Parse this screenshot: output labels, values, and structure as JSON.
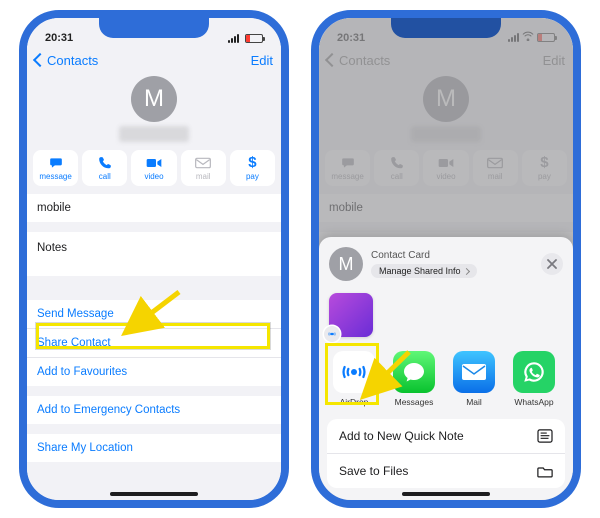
{
  "statusbar": {
    "time": "20:31"
  },
  "navbar": {
    "back_label": "Contacts",
    "edit_label": "Edit"
  },
  "avatar_initial": "M",
  "actions": {
    "message": "message",
    "call": "call",
    "video": "video",
    "mail": "mail",
    "pay": "pay"
  },
  "sections": {
    "mobile_label": "mobile",
    "notes_label": "Notes"
  },
  "links": {
    "send_message": "Send Message",
    "share_contact": "Share Contact",
    "add_favourites": "Add to Favourites",
    "add_emergency": "Add to Emergency Contacts",
    "share_location": "Share My Location"
  },
  "share_sheet": {
    "title": "Contact Card",
    "manage": "Manage Shared Info",
    "avatar_initial": "M",
    "apps": {
      "airdrop": "AirDrop",
      "messages": "Messages",
      "mail": "Mail",
      "whatsapp": "WhatsApp"
    },
    "list": {
      "quick_note": "Add to New Quick Note",
      "save_files": "Save to Files"
    }
  }
}
